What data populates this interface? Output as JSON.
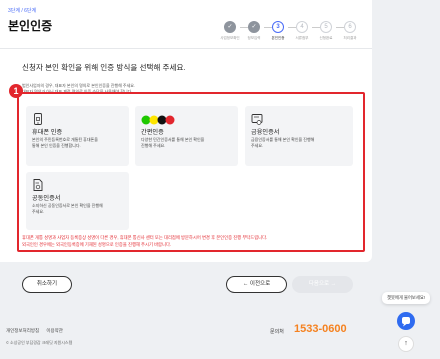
{
  "header": {
    "step_count": "3단계 / 6단계",
    "title": "본인인증"
  },
  "steps": [
    {
      "num": "✓",
      "label": "사업정보확인",
      "state": "done"
    },
    {
      "num": "✓",
      "label": "정보입력",
      "state": "done"
    },
    {
      "num": "3",
      "label": "본인인증",
      "state": "active"
    },
    {
      "num": "4",
      "label": "서류첨부",
      "state": "todo"
    },
    {
      "num": "5",
      "label": "신청완료",
      "state": "todo"
    },
    {
      "num": "6",
      "label": "처리결과",
      "state": "todo"
    }
  ],
  "main": {
    "section_title": "신청자 본인 확인을 위해 인증 방식을 선택해 주세요.",
    "note_line1": "법인사업자의 경우, 대표자 본인의 명의로 본인인증을 진행해 주세요.",
    "note_line2": "대표자 명의가 아닌 대표 계정 명의로 인증 수단을 사용해야 합니다.",
    "badge": "1",
    "methods": [
      {
        "id": "phone",
        "icon": "mobile-phone-icon",
        "title": "휴대폰 인증",
        "desc": "본인의 주민등록번호로 개통된 휴대폰을\n통해 본인 인증을 진행합니다."
      },
      {
        "id": "simple",
        "icon": "simple-auth-logos-icon",
        "title": "간편인증",
        "desc": "다양한 민간인증서를 통해 본인 확인을\n진행해 주세요."
      },
      {
        "id": "financial",
        "icon": "financial-cert-icon",
        "title": "금융인증서",
        "desc": "금융인증서를 통해 본인 확인을 진행해\n주세요."
      },
      {
        "id": "joint",
        "icon": "joint-cert-icon",
        "title": "공동인증서",
        "desc": "소지하신 공동인증서로 본인 확인을 진행해\n주세요."
      }
    ],
    "warning_line1": "휴대폰 개통 성명과 사업자 등록증상 성명이 다른 경우, 휴대폰 통신사 센터 또는 대리점에 방문하시어 변경 후 본인인증 진행 부탁드립니다.",
    "warning_line2": "외국인인 경우에는 외국인등록증에 기재된 성명으로 인증을 진행해 주시기 바랍니다."
  },
  "buttons": {
    "cancel": "취소하기",
    "prev": "← 이전으로",
    "next": "다음으로 →"
  },
  "footer": {
    "privacy": "개인정보처리방침",
    "terms": "이용약관",
    "copyright": "© 소상공인 부담경감 크레딧 지원시스템",
    "phone_label": "문의처",
    "phone": "1533-0600"
  },
  "chat": {
    "tip": "챗봇에게 물어보세요!",
    "top_label": "↑"
  },
  "colors": {
    "accent": "#4a6cf7",
    "highlight": "#e2262d",
    "phone": "#f58220",
    "chat": "#2f6bf0"
  }
}
